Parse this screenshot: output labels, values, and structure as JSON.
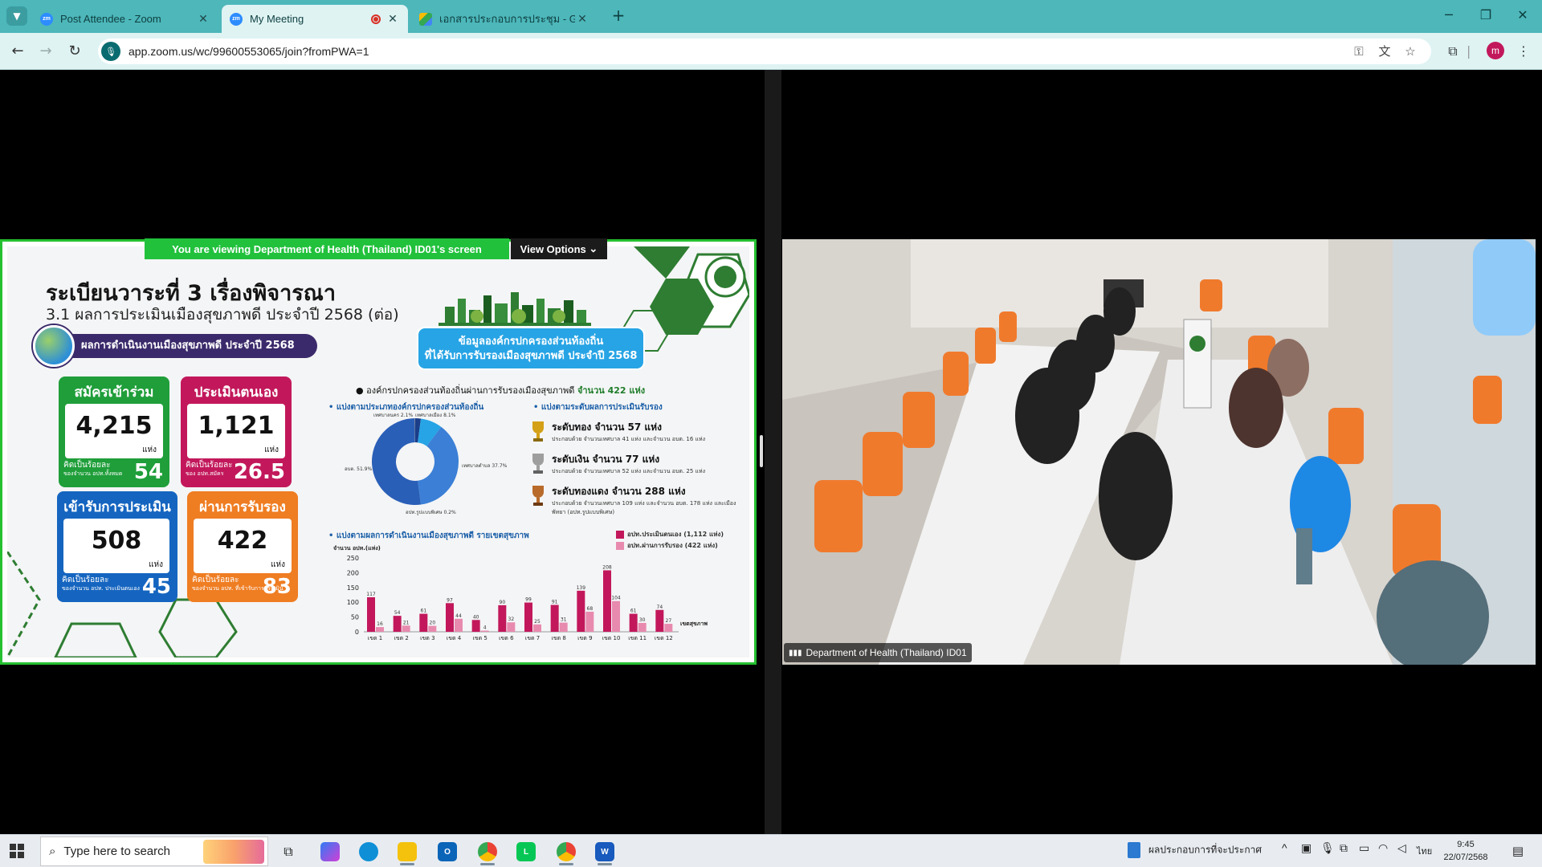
{
  "browser": {
    "tabs": [
      {
        "label": "Post Attendee - Zoom",
        "favicon": "zm"
      },
      {
        "label": "My Meeting",
        "favicon": "zm"
      },
      {
        "label": "เอกสารประกอบการประชุม - Google",
        "favicon": "drive"
      }
    ],
    "url": "app.zoom.us/wc/99600553065/join?fromPWA=1",
    "profile_initial": "m"
  },
  "meeting": {
    "banner": "You are viewing  Department of Health (Thailand) ID01's screen",
    "view_options": "View Options",
    "participant_name": "Department of Health (Thailand) ID01"
  },
  "slide": {
    "title": "ระเบียนวาระที่ 3 เรื่องพิจารณา",
    "subtitle": "3.1 ผลการประเมินเมืองสุขภาพดี ประจำปี 2568 (ต่อ)",
    "section_pill": "ผลการดำเนินงานเมืองสุขภาพดี ประจำปี 2568",
    "cards": [
      {
        "title": "สมัครเข้าร่วม",
        "value": "4,215",
        "unit": "แห่ง",
        "pct_label1": "คิดเป็นร้อยละ",
        "pct_label2": "ของจำนวน อปท.ทั้งหมด",
        "pct": "54",
        "color": "#1f9e3a"
      },
      {
        "title": "ประเมินตนเอง",
        "value": "1,121",
        "unit": "แห่ง",
        "pct_label1": "คิดเป็นร้อยละ",
        "pct_label2": "ของ อปท.สมัคร",
        "pct": "26.5",
        "color": "#c2185b"
      },
      {
        "title": "เข้ารับการประเมิน",
        "value": "508",
        "unit": "แห่ง",
        "pct_label1": "คิดเป็นร้อยละ",
        "pct_label2": "ของจำนวน อปท. ประเมินตนเอง",
        "pct": "45",
        "color": "#1565c0"
      },
      {
        "title": "ผ่านการรับรอง",
        "value": "422",
        "unit": "แห่ง",
        "pct_label1": "คิดเป็นร้อยละ",
        "pct_label2": "ของจำนวน อปท. ที่เข้ารับการประเมิน",
        "pct": "83",
        "color": "#ef7d22"
      }
    ],
    "info_box_line1": "ข้อมูลองค์กรปกครองส่วนท้องถิ่น",
    "info_box_line2": "ที่ได้รับการรับรองเมืองสุขภาพดี ประจำปี 2568",
    "bullet_main": "องค์กรปกครองส่วนท้องถิ่นผ่านการรับรองเมืองสุขภาพดี",
    "bullet_main_value": "จำนวน 422 แห่ง",
    "section_org": "แบ่งตามประเภทองค์กรปกครองส่วนท้องถิ่น",
    "section_level": "แบ่งตามระดับผลการประเมินรับรอง",
    "donut_labels": [
      "เทศบาลนคร 2.1%",
      "เทศบาลเมือง 8.1%",
      "เทศบาลตำบล 37.7%",
      "อบต. 51.9%",
      "อปท.รูปแบบพิเศษ 0.2%"
    ],
    "tiers": [
      {
        "title": "ระดับทอง จำนวน 57 แห่ง",
        "desc": "ประกอบด้วย จำนวนเทศบาล 41 แห่ง และจำนวน อบต. 16 แห่ง",
        "color": "#d4a017"
      },
      {
        "title": "ระดับเงิน จำนวน 77 แห่ง",
        "desc": "ประกอบด้วย จำนวนเทศบาล 52 แห่ง และจำนวน อบต. 25 แห่ง",
        "color": "#9e9e9e"
      },
      {
        "title": "ระดับทองแดง จำนวน 288 แห่ง",
        "desc": "ประกอบด้วย จำนวนเทศบาล 109 แห่ง และจำนวน อบต. 178 แห่ง และเมืองพัทยา (อปท.รูปแบบพิเศษ)",
        "color": "#b86b2b"
      }
    ],
    "section_region": "แบ่งตามผลการดำเนินงานเมืองสุขภาพดี รายเขตสุขภาพ",
    "legend": [
      "อปท.ประเมินตนเอง (1,112 แห่ง)",
      "อปท.ผ่านการรับรอง (422 แห่ง)"
    ]
  },
  "chart_data": [
    {
      "type": "pie",
      "categories": [
        "เทศบาลนคร",
        "เทศบาลเมือง",
        "เทศบาลตำบล",
        "อบต.",
        "อปท.รูปแบบพิเศษ"
      ],
      "values": [
        2.1,
        8.1,
        37.7,
        51.9,
        0.2
      ],
      "colors": [
        "#1b3e8a",
        "#27a4e5",
        "#3b7fd6",
        "#2a5fb8",
        "#888888"
      ]
    },
    {
      "type": "bar",
      "categories": [
        "เขต 1",
        "เขต 2",
        "เขต 3",
        "เขต 4",
        "เขต 5",
        "เขต 6",
        "เขต 7",
        "เขต 8",
        "เขต 9",
        "เขต 10",
        "เขต 11",
        "เขต 12"
      ],
      "series": [
        {
          "name": "อปท.ประเมินตนเอง (1,112 แห่ง)",
          "values": [
            117,
            54,
            61,
            97,
            40,
            90,
            99,
            91,
            139,
            208,
            61,
            74
          ],
          "color": "#c2185b"
        },
        {
          "name": "อปท.ผ่านการรับรอง (422 แห่ง)",
          "values": [
            16,
            21,
            20,
            44,
            4,
            32,
            25,
            31,
            68,
            104,
            30,
            27
          ],
          "color": "#e88aae"
        }
      ],
      "ylabel": "จำนวน อปท.(แห่ง)",
      "xlabel": "เขตสุขภาพ",
      "ylim": [
        0,
        250
      ],
      "yticks": [
        0,
        50,
        100,
        150,
        200,
        250
      ]
    }
  ],
  "taskbar": {
    "search_placeholder": "Type here to search",
    "open_doc": "ผลประกอบการที่จะประกาศ",
    "language": "ไทย",
    "time": "9:45",
    "date": "22/07/2568"
  }
}
